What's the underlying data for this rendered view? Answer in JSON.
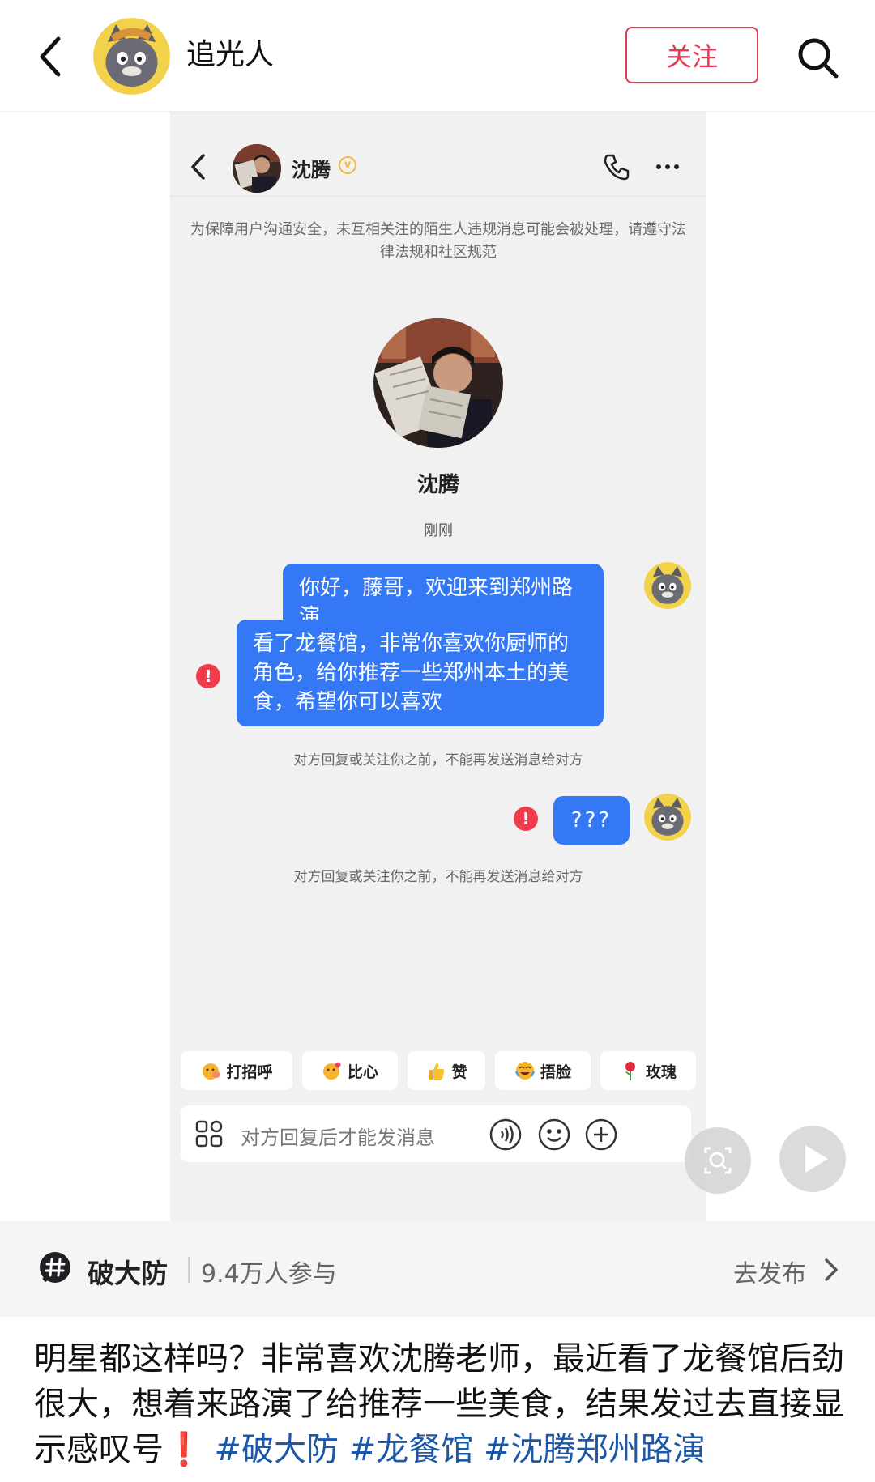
{
  "header": {
    "author_name": "追光人",
    "follow_label": "关注"
  },
  "chat": {
    "contact_name": "沈腾",
    "verified_badge": "v",
    "safety_notice": "为保障用户沟通安全，未互相关注的陌生人违规消息可能会被处理，请遵守法律法规和社区规范",
    "profile_name": "沈腾",
    "timestamp": "刚刚",
    "messages": [
      {
        "text": "你好，藤哥，欢迎来到郑州路演",
        "failed": false
      },
      {
        "text": "看了龙餐馆，非常你喜欢你厨师的角色，给你推荐一些郑州本土的美食，希望你可以喜欢",
        "failed": true
      },
      {
        "text": "???",
        "failed": true
      }
    ],
    "blocked_notice_1": "对方回复或关注你之前，不能再发送消息给对方",
    "blocked_notice_2": "对方回复或关注你之前，不能再发送消息给对方",
    "error_mark": "!",
    "quick_replies": [
      "打招呼",
      "比心",
      "赞",
      "捂脸",
      "玫瑰"
    ],
    "input_placeholder": "对方回复后才能发消息"
  },
  "topic": {
    "name": "破大防",
    "participants": "9.4万人参与",
    "publish_label": "去发布"
  },
  "post": {
    "text": "明星都这样吗？非常喜欢沈腾老师，最近看了龙餐馆后劲很大，想着来路演了给推荐一些美食，结果发过去直接显示感叹号",
    "exclaim": "❗",
    "hashtags": [
      "#破大防",
      "#龙餐馆",
      "#沈腾郑州路演"
    ]
  },
  "colors": {
    "accent_red": "#e83a55",
    "bubble_blue": "#3478f6",
    "error_red": "#f03d4d",
    "hashtag_blue": "#1d58a8"
  }
}
